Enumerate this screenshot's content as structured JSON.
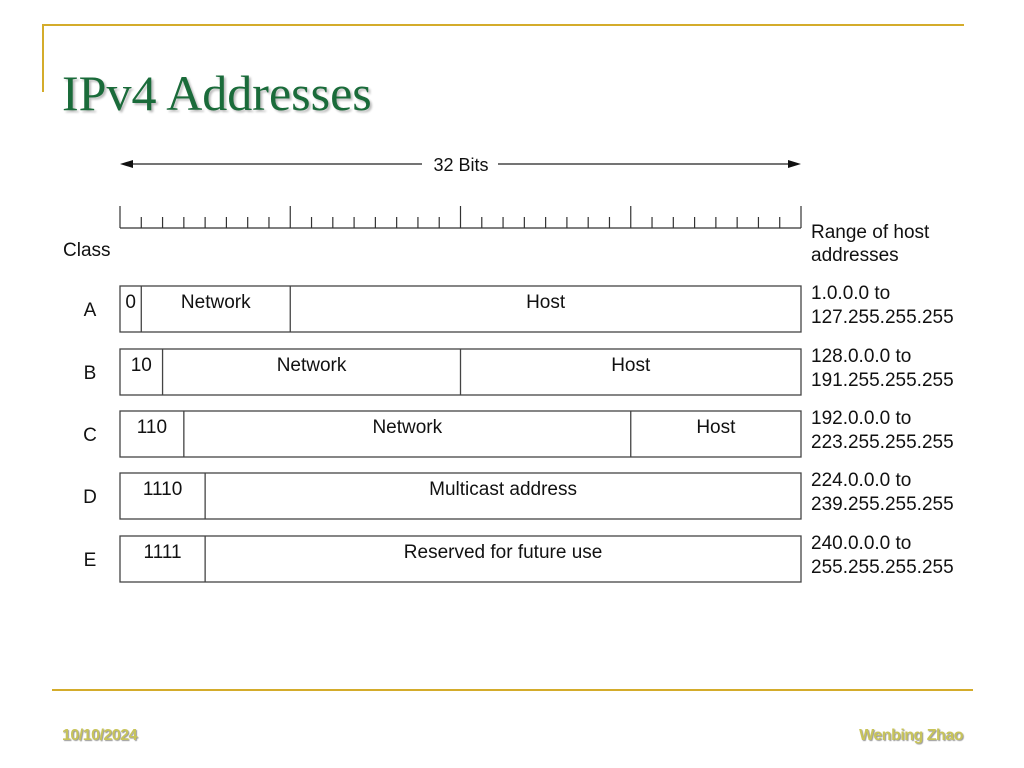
{
  "slide": {
    "title": "IPv4 Addresses",
    "footer_date": "10/10/2024",
    "footer_author": "Wenbing Zhao"
  },
  "colors": {
    "title": "#1a6b3a",
    "accent_line": "#d4ac2b",
    "footer_text": "#c8c45a"
  },
  "diagram": {
    "width_label": "32 Bits",
    "total_bits": 32,
    "bits_per_byte": 8,
    "class_header": "Class",
    "range_header_line1": "Range of host",
    "range_header_line2": "addresses",
    "classes": [
      {
        "name": "A",
        "segments": [
          {
            "label": "0",
            "bits": 1
          },
          {
            "label": "Network",
            "bits": 7
          },
          {
            "label": "Host",
            "bits": 24
          }
        ],
        "range_line1": "1.0.0.0 to",
        "range_line2": "127.255.255.255"
      },
      {
        "name": "B",
        "segments": [
          {
            "label": "10",
            "bits": 2
          },
          {
            "label": "Network",
            "bits": 14
          },
          {
            "label": "Host",
            "bits": 16
          }
        ],
        "range_line1": "128.0.0.0 to",
        "range_line2": "191.255.255.255"
      },
      {
        "name": "C",
        "segments": [
          {
            "label": "110",
            "bits": 3
          },
          {
            "label": "Network",
            "bits": 21
          },
          {
            "label": "Host",
            "bits": 8
          }
        ],
        "range_line1": "192.0.0.0 to",
        "range_line2": "223.255.255.255"
      },
      {
        "name": "D",
        "segments": [
          {
            "label": "1110",
            "bits": 4
          },
          {
            "label": "Multicast address",
            "bits": 28
          }
        ],
        "range_line1": "224.0.0.0 to",
        "range_line2": "239.255.255.255"
      },
      {
        "name": "E",
        "segments": [
          {
            "label": "1111",
            "bits": 4
          },
          {
            "label": "Reserved for future use",
            "bits": 28
          }
        ],
        "range_line1": "240.0.0.0 to",
        "range_line2": "255.255.255.255"
      }
    ]
  }
}
